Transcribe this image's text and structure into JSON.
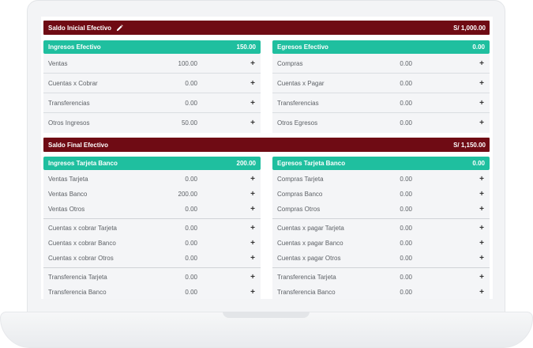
{
  "saldo_inicial": {
    "label": "Saldo Inicial Efectivo",
    "amount": "S/ 1,000.00"
  },
  "ingresos_efectivo": {
    "title": "Ingresos Efectivo",
    "total": "150.00",
    "rows": [
      {
        "label": "Ventas",
        "value": "100.00"
      },
      {
        "label": "Cuentas x Cobrar",
        "value": "0.00"
      },
      {
        "label": "Transferencias",
        "value": "0.00"
      },
      {
        "label": "Otros Ingresos",
        "value": "50.00"
      }
    ]
  },
  "egresos_efectivo": {
    "title": "Egresos Efectivo",
    "total": "0.00",
    "rows": [
      {
        "label": "Compras",
        "value": "0.00"
      },
      {
        "label": "Cuentas x Pagar",
        "value": "0.00"
      },
      {
        "label": "Transferencias",
        "value": "0.00"
      },
      {
        "label": "Otros Egresos",
        "value": "0.00"
      }
    ]
  },
  "saldo_final": {
    "label": "Saldo Final Efectivo",
    "amount": "S/ 1,150.00"
  },
  "ingresos_tarjeta": {
    "title": "Ingresos Tarjeta Banco",
    "total": "200.00",
    "groups": [
      [
        {
          "label": "Ventas Tarjeta",
          "value": "0.00"
        },
        {
          "label": "Ventas Banco",
          "value": "200.00"
        },
        {
          "label": "Ventas Otros",
          "value": "0.00"
        }
      ],
      [
        {
          "label": "Cuentas x cobrar Tarjeta",
          "value": "0.00"
        },
        {
          "label": "Cuentas x cobrar Banco",
          "value": "0.00"
        },
        {
          "label": "Cuentas x cobrar Otros",
          "value": "0.00"
        }
      ],
      [
        {
          "label": "Transferencia Tarjeta",
          "value": "0.00"
        },
        {
          "label": "Transferencia Banco",
          "value": "0.00"
        }
      ]
    ]
  },
  "egresos_tarjeta": {
    "title": "Egresos Tarjeta Banco",
    "total": "0.00",
    "groups": [
      [
        {
          "label": "Compras Tarjeta",
          "value": "0.00"
        },
        {
          "label": "Compras Banco",
          "value": "0.00"
        },
        {
          "label": "Compras Otros",
          "value": "0.00"
        }
      ],
      [
        {
          "label": "Cuentas x pagar Tarjeta",
          "value": "0.00"
        },
        {
          "label": "Cuentas x pagar Banco",
          "value": "0.00"
        },
        {
          "label": "Cuentas x pagar Otros",
          "value": "0.00"
        }
      ],
      [
        {
          "label": "Transferencia Tarjeta",
          "value": "0.00"
        },
        {
          "label": "Transferencia Banco",
          "value": "0.00"
        }
      ]
    ]
  },
  "add_symbol": "+",
  "colors": {
    "dark_red": "#6f0b14",
    "teal": "#1fbf9f"
  },
  "icons": {
    "edit": "pencil-icon",
    "add": "plus-icon"
  }
}
